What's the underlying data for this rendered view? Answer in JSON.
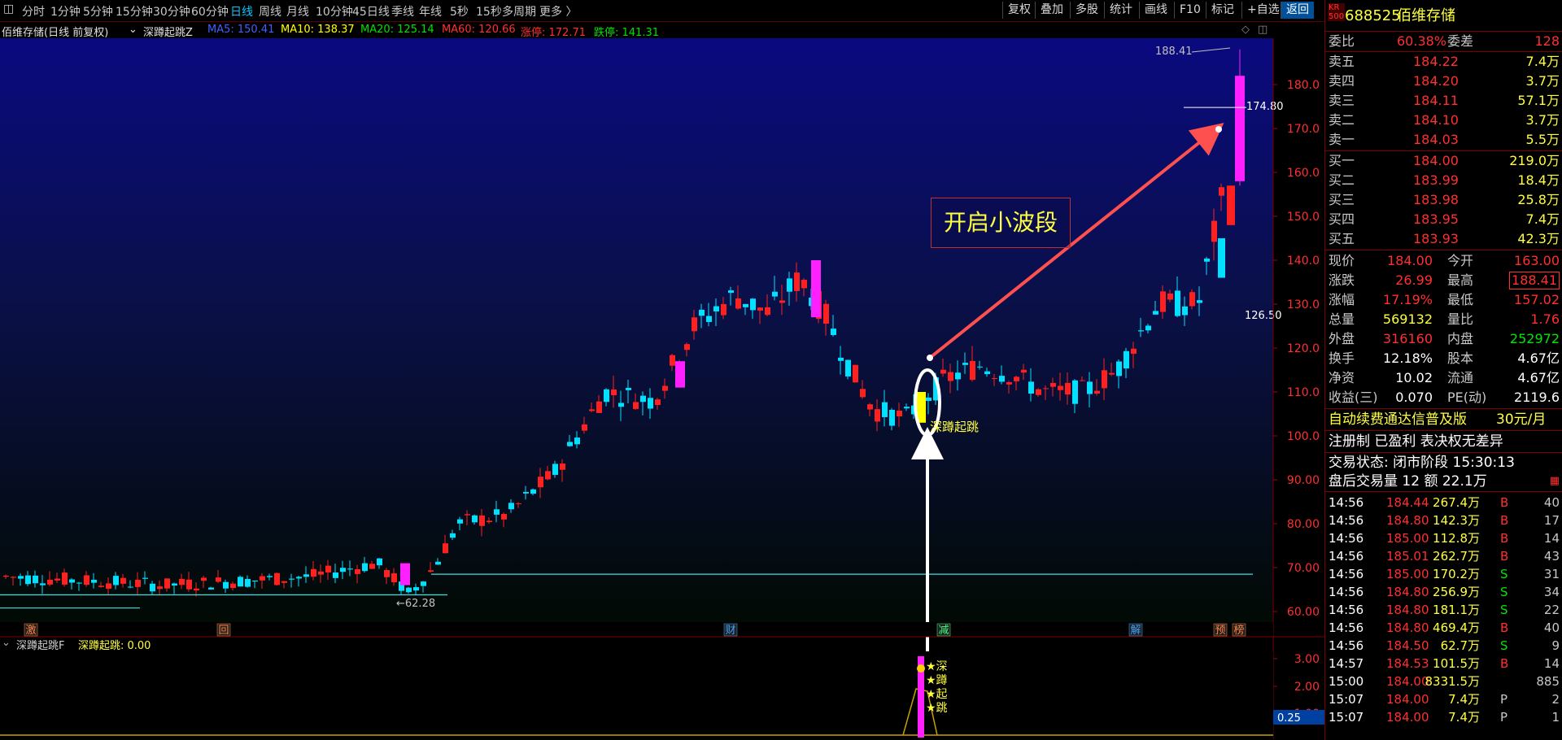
{
  "toolbar": {
    "periods": [
      "分时",
      "1分钟",
      "5分钟",
      "15分钟",
      "30分钟",
      "60分钟",
      "日线",
      "周线",
      "月线",
      "10分钟",
      "45日线",
      "季线",
      "年线",
      "5秒",
      "15秒",
      "多周期",
      "更多 〉"
    ],
    "active_period": "日线",
    "buttons": [
      "复权",
      "叠加",
      "多股",
      "统计",
      "画线",
      "F10",
      "标记",
      "+自选",
      "返回"
    ]
  },
  "chart_header": {
    "title": "佰维存储(日线 前复权)",
    "indicator": "深蹲起跳Z",
    "ma5": "MA5: 150.41",
    "ma10": "MA10: 138.37",
    "ma20": "MA20: 125.14",
    "ma60": "MA60: 120.66",
    "limit_up": "涨停: 172.71",
    "limit_down": "跌停: 141.31"
  },
  "price_axis": [
    "180.0",
    "170.0",
    "160.0",
    "150.0",
    "140.0",
    "130.0",
    "120.0",
    "110.0",
    "100.0",
    "90.00",
    "80.00",
    "70.00",
    "60.00"
  ],
  "price_labels": {
    "high": "188.41",
    "hline": "174.80",
    "level": "126.50",
    "low": "←62.28"
  },
  "annotation": {
    "box_text": "开启小波段",
    "signal_label": "深蹲起跳"
  },
  "event_markers": [
    "激",
    "回",
    "财",
    "减",
    "解",
    "预",
    "榜"
  ],
  "indicator_panel": {
    "name": "深蹲起跳F",
    "value_label": "深蹲起跳: 0.00",
    "axis": [
      "3.00",
      "2.00",
      "1.00"
    ],
    "current": "0.25",
    "stars": [
      "★深",
      "★蹲",
      "★起",
      "★跳"
    ]
  },
  "stock": {
    "tag_top": "KR",
    "tag_bottom": "500",
    "code": "688525",
    "name": "佰维存储"
  },
  "order_book": {
    "ratio_label": "委比",
    "ratio_value": "60.38%",
    "diff_label": "委差",
    "diff_value": "128",
    "asks": [
      {
        "label": "卖五",
        "price": "184.22",
        "vol": "7.4万"
      },
      {
        "label": "卖四",
        "price": "184.20",
        "vol": "3.7万"
      },
      {
        "label": "卖三",
        "price": "184.11",
        "vol": "57.1万"
      },
      {
        "label": "卖二",
        "price": "184.10",
        "vol": "3.7万"
      },
      {
        "label": "卖一",
        "price": "184.03",
        "vol": "5.5万"
      }
    ],
    "bids": [
      {
        "label": "买一",
        "price": "184.00",
        "vol": "219.0万"
      },
      {
        "label": "买二",
        "price": "183.99",
        "vol": "18.4万"
      },
      {
        "label": "买三",
        "price": "183.98",
        "vol": "25.8万"
      },
      {
        "label": "买四",
        "price": "183.95",
        "vol": "7.4万"
      },
      {
        "label": "买五",
        "price": "183.93",
        "vol": "42.3万"
      }
    ]
  },
  "quote": [
    {
      "l1": "现价",
      "v1": "184.00",
      "l2": "今开",
      "v2": "163.00"
    },
    {
      "l1": "涨跌",
      "v1": "26.99",
      "l2": "最高",
      "v2": "188.41"
    },
    {
      "l1": "涨幅",
      "v1": "17.19%",
      "l2": "最低",
      "v2": "157.02"
    },
    {
      "l1": "总量",
      "v1": "569132",
      "l2": "量比",
      "v2": "1.76"
    },
    {
      "l1": "外盘",
      "v1": "316160",
      "l2": "内盘",
      "v2": "252972"
    },
    {
      "l1": "换手",
      "v1": "12.18%",
      "l2": "股本",
      "v2": "4.67亿"
    },
    {
      "l1": "净资",
      "v1": "10.02",
      "l2": "流通",
      "v2": "4.67亿"
    },
    {
      "l1": "收益(三)",
      "v1": "0.070",
      "l2": "PE(动)",
      "v2": "2119.6"
    }
  ],
  "info": {
    "promo": "自动续费通达信普及版",
    "promo_price": "30元/月",
    "tags": "注册制 已盈利 表决权无差异",
    "status": "交易状态: 闭市阶段 15:30:13",
    "after_hours": "盘后交易量 12 额 22.1万"
  },
  "ticks": [
    {
      "t": "14:56",
      "p": "184.44",
      "a": "267.4万",
      "d": "B",
      "n": "40"
    },
    {
      "t": "14:56",
      "p": "184.80",
      "a": "142.3万",
      "d": "B",
      "n": "17"
    },
    {
      "t": "14:56",
      "p": "185.00",
      "a": "112.8万",
      "d": "B",
      "n": "14"
    },
    {
      "t": "14:56",
      "p": "185.01",
      "a": "262.7万",
      "d": "B",
      "n": "43"
    },
    {
      "t": "14:56",
      "p": "185.00",
      "a": "170.2万",
      "d": "S",
      "n": "31"
    },
    {
      "t": "14:56",
      "p": "184.80",
      "a": "256.9万",
      "d": "S",
      "n": "34"
    },
    {
      "t": "14:56",
      "p": "184.80",
      "a": "181.1万",
      "d": "S",
      "n": "22"
    },
    {
      "t": "14:56",
      "p": "184.80",
      "a": "469.4万",
      "d": "B",
      "n": "40"
    },
    {
      "t": "14:56",
      "p": "184.50",
      "a": "62.7万",
      "d": "S",
      "n": "9"
    },
    {
      "t": "14:57",
      "p": "184.53",
      "a": "101.5万",
      "d": "B",
      "n": "14"
    },
    {
      "t": "15:00",
      "p": "184.00",
      "a": "8331.5万",
      "d": "",
      "n": "885"
    },
    {
      "t": "15:07",
      "p": "184.00",
      "a": "7.4万",
      "d": "P",
      "n": "2"
    },
    {
      "t": "15:07",
      "p": "184.00",
      "a": "7.4万",
      "d": "P",
      "n": "1"
    }
  ],
  "colors": {
    "up": "#ff2020",
    "down": "#00e0ff",
    "bg_top": "#0a0a78",
    "magenta": "#ff20ff",
    "accent": "#ffff00"
  }
}
